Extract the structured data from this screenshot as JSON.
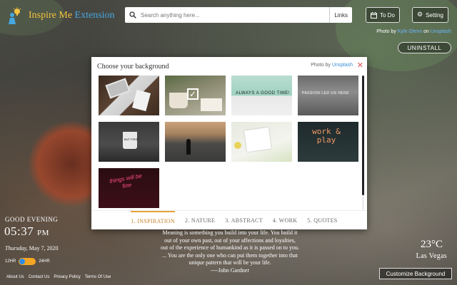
{
  "app": {
    "logo_text_main": "Inspire Me",
    "logo_text_accent": "Extension",
    "logo_icon": "person-lightbulb-icon"
  },
  "search": {
    "placeholder": "Search anything here...",
    "links_label": "Links",
    "icon": "search-icon"
  },
  "header": {
    "todo_label": "To Do",
    "setting_label": "Setting",
    "photo_by": "Photo by",
    "photographer": "Kyle Glenn",
    "on": "on",
    "source": "Unsplash",
    "uninstall_label": "UNINSTALL"
  },
  "modal": {
    "title": "Choose your background",
    "photo_by": "Photo by",
    "source": "Unsplash",
    "close_icon": "close-icon",
    "scroll_position": 0,
    "thumbnails": [
      {
        "name": "thumb-laptop-desk",
        "selected": false,
        "text": ""
      },
      {
        "name": "thumb-coffee-cup",
        "selected": true,
        "text": ""
      },
      {
        "name": "thumb-always-a-good-time",
        "selected": false,
        "text": "ALWAYS A GOOD TIME!"
      },
      {
        "name": "thumb-passion-led-us-here",
        "selected": false,
        "text": "PASSION LED US HERE"
      },
      {
        "name": "thumb-but-first-mug",
        "selected": false,
        "text": "BUT FIRST"
      },
      {
        "name": "thumb-road-person",
        "selected": false,
        "text": ""
      },
      {
        "name": "thumb-writing-flowers",
        "selected": false,
        "text": ""
      },
      {
        "name": "thumb-work-and-play",
        "selected": false,
        "text": "work & play"
      },
      {
        "name": "thumb-neon-sign",
        "selected": false,
        "text": "things will be fine"
      }
    ],
    "tabs": [
      {
        "label": "1. INSPIRATION",
        "active": true
      },
      {
        "label": "2. NATURE",
        "active": false
      },
      {
        "label": "3. ABSTRACT",
        "active": false
      },
      {
        "label": "4. WORK",
        "active": false
      },
      {
        "label": "5. QUOTES",
        "active": false
      }
    ]
  },
  "clock": {
    "greeting": "GOOD EVENING",
    "time": "05:37",
    "ampm": "PM",
    "weekday": "Thursday,",
    "date": "May 7, 2020",
    "format_12": "12HR",
    "format_24": "24HR"
  },
  "quote": {
    "text": "Meaning is something you build into your life. You build it out of your own past, out of your affections and loyalties, out of the experience of humankind as it is passed on to you. ... You are the only one who can put them together into that unique pattern that will be your life.",
    "author": "----John Gardner"
  },
  "weather": {
    "temperature": "23°C",
    "city": "Las Vegas"
  },
  "footer": {
    "links": [
      "About Us",
      "Contact Us",
      "Privacy Policy",
      "Terms Of Use"
    ],
    "customize_label": "Customize Background"
  },
  "colors": {
    "logo_gold": "#f3c340",
    "logo_blue": "#46a8e0",
    "tab_active": "#e8a33a",
    "close_red": "#e05050",
    "link_blue": "#6cb6ff",
    "toggle_track": "#f5a623",
    "toggle_knob": "#2e8be6"
  }
}
